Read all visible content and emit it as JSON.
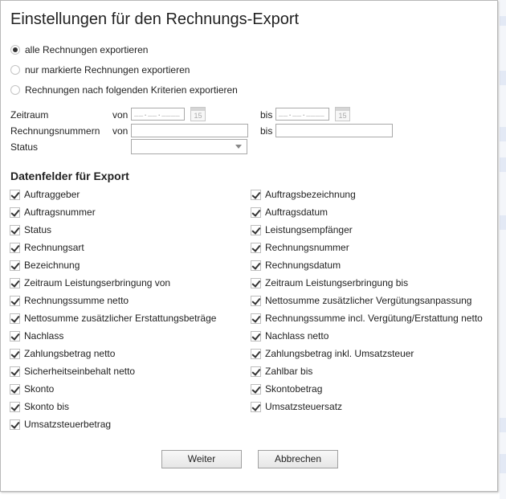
{
  "dialog": {
    "title": "Einstellungen für den Rechnungs-Export"
  },
  "export_options": [
    {
      "label": "alle Rechnungen exportieren",
      "selected": true
    },
    {
      "label": "nur markierte Rechnungen exportieren",
      "selected": false
    },
    {
      "label": "Rechnungen nach folgenden Kriterien exportieren",
      "selected": false
    }
  ],
  "criteria": {
    "zeitraum_label": "Zeitraum",
    "rechnungsnummern_label": "Rechnungsnummern",
    "status_label": "Status",
    "von_label": "von",
    "bis_label": "bis",
    "date_placeholder": "__.__.____",
    "calendar_day": "15",
    "rechnungsnummer_von_value": "",
    "rechnungsnummer_bis_value": "",
    "status_value": ""
  },
  "fields_section": {
    "title": "Datenfelder für Export",
    "left": [
      {
        "label": "Auftraggeber",
        "checked": true
      },
      {
        "label": "Auftragsnummer",
        "checked": true
      },
      {
        "label": "Status",
        "checked": true
      },
      {
        "label": "Rechnungsart",
        "checked": true
      },
      {
        "label": "Bezeichnung",
        "checked": true
      },
      {
        "label": "Zeitraum Leistungserbringung von",
        "checked": true
      },
      {
        "label": "Rechnungssumme netto",
        "checked": true
      },
      {
        "label": "Nettosumme zusätzlicher Erstattungsbeträge",
        "checked": true
      },
      {
        "label": "Nachlass",
        "checked": true
      },
      {
        "label": "Zahlungsbetrag netto",
        "checked": true
      },
      {
        "label": "Sicherheitseinbehalt netto",
        "checked": true
      },
      {
        "label": "Skonto",
        "checked": true
      },
      {
        "label": "Skonto bis",
        "checked": true
      },
      {
        "label": "Umsatzsteuerbetrag",
        "checked": true
      }
    ],
    "right": [
      {
        "label": "Auftragsbezeichnung",
        "checked": true
      },
      {
        "label": "Auftragsdatum",
        "checked": true
      },
      {
        "label": "Leistungsempfänger",
        "checked": true
      },
      {
        "label": "Rechnungsnummer",
        "checked": true
      },
      {
        "label": "Rechnungsdatum",
        "checked": true
      },
      {
        "label": "Zeitraum Leistungserbringung bis",
        "checked": true
      },
      {
        "label": "Nettosumme zusätzlicher Vergütungsanpassung",
        "checked": true
      },
      {
        "label": "Rechnungssumme incl. Vergütung/Erstattung netto",
        "checked": true
      },
      {
        "label": "Nachlass netto",
        "checked": true
      },
      {
        "label": "Zahlungsbetrag inkl. Umsatzsteuer",
        "checked": true
      },
      {
        "label": "Zahlbar bis",
        "checked": true
      },
      {
        "label": "Skontobetrag",
        "checked": true
      },
      {
        "label": "Umsatzsteuersatz",
        "checked": true
      }
    ]
  },
  "buttons": {
    "weiter_label": "Weiter",
    "abbrechen_label": "Abbrechen"
  }
}
